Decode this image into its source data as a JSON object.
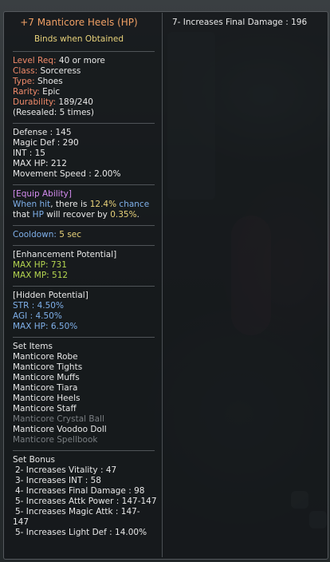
{
  "item": {
    "title": "+7 Manticore Heels (HP)",
    "binds": "Binds when Obtained"
  },
  "info": [
    {
      "label": "Level Req:",
      "value": " 40 or more"
    },
    {
      "label": "Class:",
      "value": " Sorceress"
    },
    {
      "label": "Type:",
      "value": " Shoes"
    },
    {
      "label": "Rarity:",
      "value": " Epic"
    },
    {
      "label": "Durability:",
      "value": " 189/240"
    }
  ],
  "resealed": "(Resealed: 5 times)",
  "stats": [
    "Defense : 145",
    "Magic Def : 290",
    "INT : 15",
    "MAX HP: 212",
    "Movement Speed : 2.00%"
  ],
  "equip": {
    "header": "[Equip Ability]",
    "line1": {
      "a": "When hit",
      "b": ", there is ",
      "c": "12.4%",
      "d": " chance"
    },
    "line2": {
      "a": "that ",
      "b": "HP",
      "c": " will recover by ",
      "d": "0.35%",
      "e": "."
    }
  },
  "cooldown": {
    "label": "Cooldown:",
    "value": " 5 sec"
  },
  "enhancement": {
    "header": "[Enhancement Potential]",
    "lines": [
      "MAX HP: 731",
      "MAX MP: 512"
    ]
  },
  "hidden": {
    "header": "[Hidden Potential]",
    "lines": [
      "STR : 4.50%",
      "AGI : 4.50%",
      "MAX HP: 6.50%"
    ]
  },
  "set_items": {
    "header": "Set Items",
    "items": [
      {
        "name": "Manticore Robe",
        "owned": true
      },
      {
        "name": "Manticore Tights",
        "owned": true
      },
      {
        "name": "Manticore Muffs",
        "owned": true
      },
      {
        "name": "Manticore Tiara",
        "owned": true
      },
      {
        "name": "Manticore Heels",
        "owned": true
      },
      {
        "name": "Manticore Staff",
        "owned": true
      },
      {
        "name": "Manticore Crystal Ball",
        "owned": false
      },
      {
        "name": "Manticore Voodoo Doll",
        "owned": true
      },
      {
        "name": "Manticore Spellbook",
        "owned": false
      }
    ]
  },
  "set_bonus": {
    "header": "Set Bonus",
    "lines": [
      "2- Increases Vitality : 47",
      "3- Increases INT : 58",
      "4- Increases Final Damage : 98",
      "5- Increases Attk Power : 147-147",
      "5- Increases Magic Attk : 147-",
      "147",
      "5- Increases Light Def : 14.00%"
    ]
  },
  "right_column": [
    "7- Increases Final Damage : 196"
  ],
  "colors": {
    "title": "#f0a065",
    "label": "#f08a6a",
    "gold": "#e8d27a",
    "equip_header": "#d58cf0",
    "potential_blue": "#7fb0ea",
    "enhance_green": "#b5d650",
    "unowned_gray": "#7a7e82"
  }
}
